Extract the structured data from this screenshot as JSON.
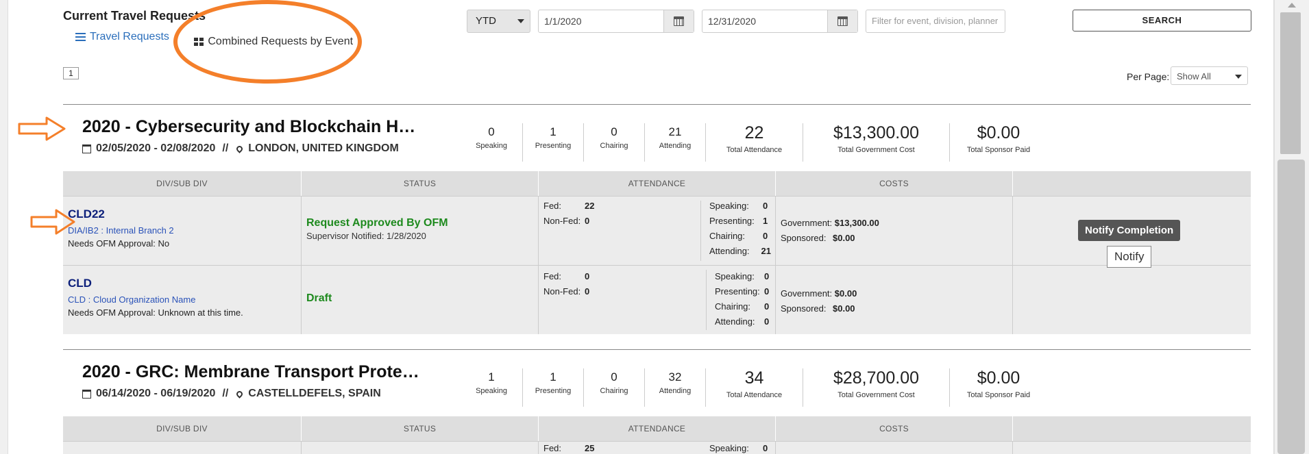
{
  "header": {
    "title": "Current Travel Requests",
    "tab_requests": "Travel Requests",
    "tab_combined": "Combined Requests by Event"
  },
  "filters": {
    "period": "YTD",
    "start_date": "1/1/2020",
    "end_date": "12/31/2020",
    "filter_placeholder": "Filter for event, division, planner",
    "search_label": "SEARCH"
  },
  "pager": {
    "current_page": "1",
    "per_page_label": "Per Page:",
    "per_page_value": "Show All"
  },
  "table_headers": [
    "DIV/SUB DIV",
    "STATUS",
    "ATTENDANCE",
    "COSTS",
    ""
  ],
  "events": [
    {
      "title": "2020 - Cybersecurity and Blockchain H…",
      "dates": "02/05/2020 - 02/08/2020",
      "separator": "//",
      "location": "LONDON, UNITED KINGDOM",
      "stats": [
        {
          "num": "0",
          "lbl": "Speaking"
        },
        {
          "num": "1",
          "lbl": "Presenting"
        },
        {
          "num": "0",
          "lbl": "Chairing"
        },
        {
          "num": "21",
          "lbl": "Attending"
        }
      ],
      "total_attendance": {
        "num": "22",
        "lbl": "Total Attendance"
      },
      "gov_cost": {
        "num": "$13,300.00",
        "lbl": "Total Government Cost"
      },
      "sponsor_paid": {
        "num": "$0.00",
        "lbl": "Total Sponsor Paid"
      },
      "rows": [
        {
          "code": "CLD22",
          "name": "DIA/IB2 : Internal Branch 2",
          "note": "Needs OFM Approval: No",
          "status": "Request Approved By OFM",
          "status_sub": "Supervisor Notified: 1/28/2020",
          "fed_label": "Fed:",
          "fed": "22",
          "nonfed_label": "Non-Fed:",
          "nonfed": "0",
          "speaking_label": "Speaking:",
          "speaking": "0",
          "presenting_label": "Presenting:",
          "presenting": "1",
          "chairing_label": "Chairing:",
          "chairing": "0",
          "attending_label": "Attending:",
          "attending": "21",
          "gov_label": "Government:",
          "gov": "$13,300.00",
          "spon_label": "Sponsored:",
          "spon": "$0.00",
          "action": "Notify Completion",
          "tooltip": "Notify"
        },
        {
          "code": "CLD",
          "name": "CLD : Cloud Organization Name",
          "note": "Needs OFM Approval: Unknown at this time.",
          "status": "Draft",
          "fed_label": "Fed:",
          "fed": "0",
          "nonfed_label": "Non-Fed:",
          "nonfed": "0",
          "speaking_label": "Speaking:",
          "speaking": "0",
          "presenting_label": "Presenting:",
          "presenting": "0",
          "chairing_label": "Chairing:",
          "chairing": "0",
          "attending_label": "Attending:",
          "attending": "0",
          "gov_label": "Government:",
          "gov": "$0.00",
          "spon_label": "Sponsored:",
          "spon": "$0.00"
        }
      ]
    },
    {
      "title": "2020 - GRC: Membrane Transport Prote…",
      "dates": "06/14/2020 - 06/19/2020",
      "separator": "//",
      "location": "CASTELLDEFELS, SPAIN",
      "stats": [
        {
          "num": "1",
          "lbl": "Speaking"
        },
        {
          "num": "1",
          "lbl": "Presenting"
        },
        {
          "num": "0",
          "lbl": "Chairing"
        },
        {
          "num": "32",
          "lbl": "Attending"
        }
      ],
      "total_attendance": {
        "num": "34",
        "lbl": "Total Attendance"
      },
      "gov_cost": {
        "num": "$28,700.00",
        "lbl": "Total Government Cost"
      },
      "sponsor_paid": {
        "num": "$0.00",
        "lbl": "Total Sponsor Paid"
      },
      "rows": [
        {
          "fed_label": "Fed:",
          "fed": "25",
          "speaking_label": "Speaking:",
          "speaking": "0"
        }
      ]
    }
  ],
  "colors": {
    "accent_orange": "#f47f2a",
    "link_blue": "#2a6ebb",
    "status_green": "#1e8a1e",
    "code_navy": "#0c1f7a"
  }
}
